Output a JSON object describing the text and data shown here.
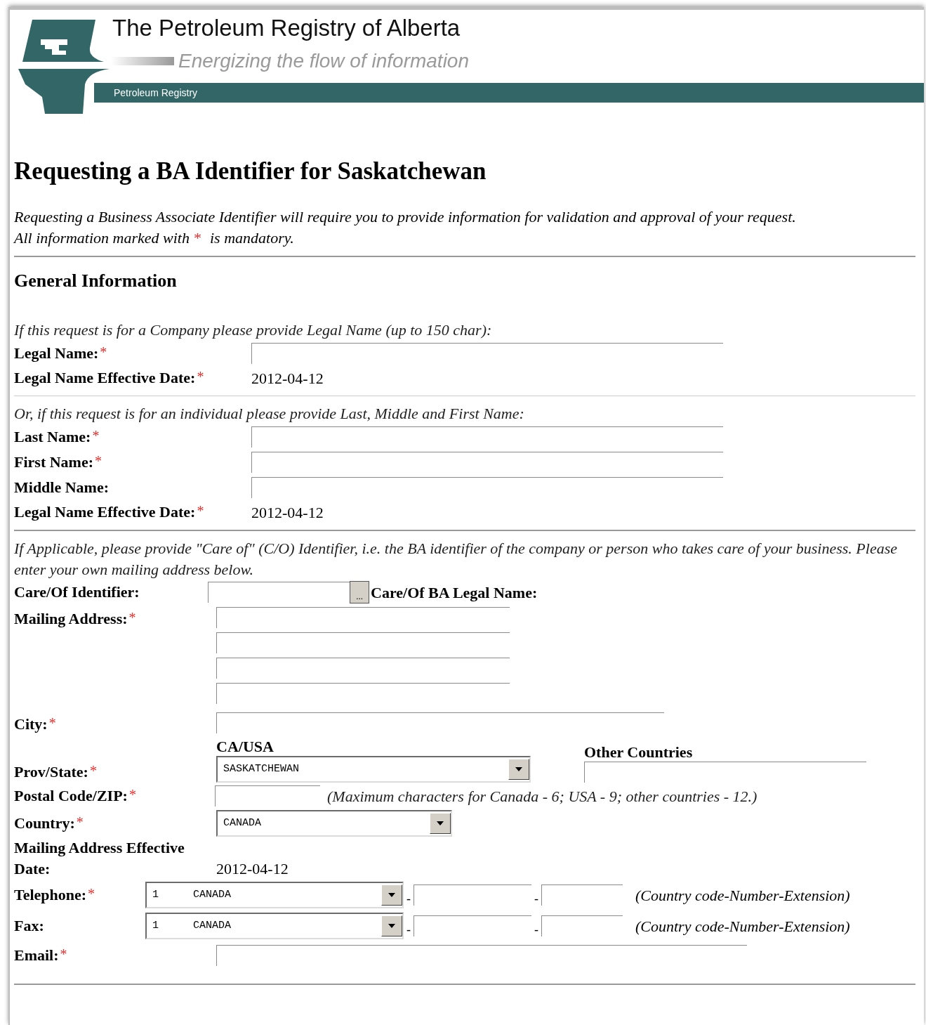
{
  "header": {
    "title": "The Petroleum Registry of Alberta",
    "tagline": "Energizing the flow of information",
    "bar_label": "Petroleum Registry"
  },
  "page_title": "Requesting a BA Identifier for Saskatchewan",
  "intro": "Requesting a Business Associate Identifier will require you to provide information for validation and approval of your request.",
  "mandatory_note": {
    "before": "All information marked with",
    "mark": "*",
    "after": "is mandatory."
  },
  "section_title": "General Information",
  "company": {
    "prompt": "If this request is for a Company please provide Legal Name (up to 150 char):",
    "fields": [
      {
        "kind": "input",
        "label": "Legal Name:",
        "required": true
      },
      {
        "kind": "date",
        "label": "Legal Name Effective Date:",
        "required": true,
        "value": "2012-04-12"
      }
    ]
  },
  "individual": {
    "prompt": "Or, if this request is for an individual please provide Last, Middle and First Name:",
    "fields": [
      {
        "kind": "input",
        "label": "Last Name:",
        "required": true
      },
      {
        "kind": "input",
        "label": "First Name:",
        "required": true
      },
      {
        "kind": "input",
        "label": "Middle Name:",
        "required": false
      },
      {
        "kind": "date",
        "label": "Legal Name Effective Date:",
        "required": true,
        "value": "2012-04-12"
      }
    ]
  },
  "address": {
    "prompt": "If Applicable, please provide \"Care of\" (C/O) Identifier, i.e. the BA identifier of the company or person who takes care of your business. Please enter your own mailing address below.",
    "care_of": {
      "label": "Care/Of Identifier:",
      "button": "...",
      "legal_name_label": "Care/Of BA Legal Name:"
    },
    "mailing": {
      "label": "Mailing Address:",
      "required": true
    },
    "city": {
      "label": "City:",
      "required": true
    },
    "prov_state": {
      "heading": "CA/USA",
      "other_heading": "Other Countries",
      "label": "Prov/State:",
      "required": true,
      "value": "SASKATCHEWAN"
    },
    "postal": {
      "label": "Postal Code/ZIP:",
      "required": true,
      "note": "(Maximum characters for Canada - 6; USA - 9; other countries - 12.)"
    },
    "country": {
      "label": "Country:",
      "required": true,
      "value": "CANADA"
    },
    "effective": {
      "label": "Mailing Address Effective Date:",
      "value": "2012-04-12"
    },
    "phones": [
      {
        "label": "Telephone:",
        "required": true,
        "code": "1",
        "country": "CANADA",
        "separators": [
          "-",
          "-"
        ],
        "note": "(Country code-Number-Extension)"
      },
      {
        "label": "Fax:",
        "required": false,
        "code": "1",
        "country": "CANADA",
        "separators": [
          "-",
          "-"
        ],
        "note": "(Country code-Number-Extension)"
      }
    ],
    "email": {
      "label": "Email:",
      "required": true
    }
  }
}
